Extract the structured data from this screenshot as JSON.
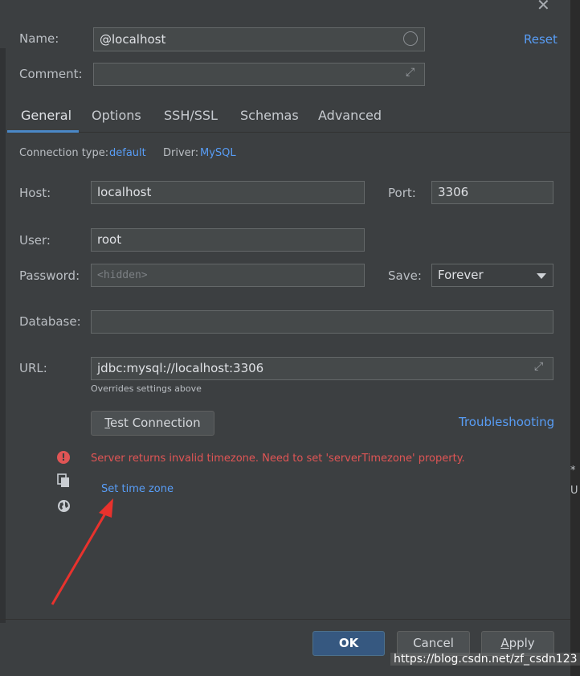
{
  "form": {
    "name_label": "Name:",
    "name_value": "@localhost",
    "comment_label": "Comment:",
    "comment_value": "",
    "reset_link": "Reset"
  },
  "tabs": [
    {
      "label": "General",
      "active": true
    },
    {
      "label": "Options"
    },
    {
      "label": "SSH/SSL"
    },
    {
      "label": "Schemas"
    },
    {
      "label": "Advanced"
    }
  ],
  "general": {
    "connection_type_label": "Connection type:",
    "connection_type_value": "default",
    "driver_label": "Driver:",
    "driver_value": "MySQL",
    "host_label": "Host:",
    "host_value": "localhost",
    "port_label": "Port:",
    "port_value": "3306",
    "user_label": "User:",
    "user_value": "root",
    "password_label": "Password:",
    "password_placeholder": "<hidden>",
    "save_label": "Save:",
    "save_value": "Forever",
    "database_label": "Database:",
    "database_value": "",
    "url_label": "URL:",
    "url_value": "jdbc:mysql://localhost:3306",
    "url_hint": "Overrides settings above",
    "test_connection_label": "Test Connection",
    "troubleshooting_link": "Troubleshooting"
  },
  "error": {
    "message": "Server returns invalid timezone. Need to set 'serverTimezone' property.",
    "action_link": "Set time zone"
  },
  "footer": {
    "ok_label": "OK",
    "cancel_label": "Cancel",
    "apply_label": "Apply"
  },
  "watermark": "https://blog.csdn.net/zf_csdn123",
  "edge_text": [
    "*",
    "U"
  ],
  "colors": {
    "background": "#3c3f41",
    "link": "#589df6",
    "error": "#e05555",
    "primary_button": "#365880",
    "annotation_arrow": "#e8322d"
  },
  "icons": [
    "close-icon",
    "circle-icon",
    "expand-icon",
    "error-icon",
    "copy-icon",
    "globe-icon",
    "dropdown-arrow-icon"
  ]
}
